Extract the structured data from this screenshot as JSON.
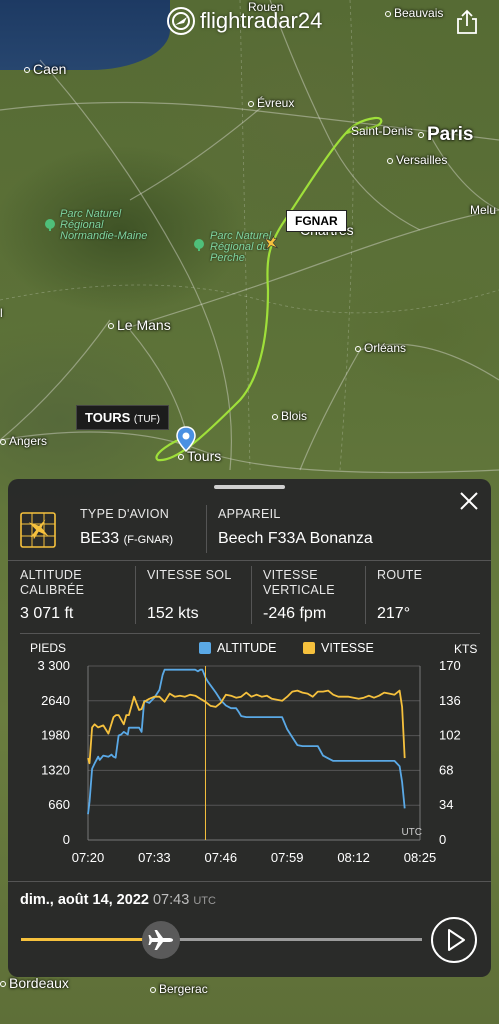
{
  "app": {
    "logo_text": "flightradar24"
  },
  "map": {
    "places": {
      "rouen": "Rouen",
      "beauvais": "Beauvais",
      "caen": "Caen",
      "evreux": "Évreux",
      "saint_denis": "Saint-Denis",
      "paris": "Paris",
      "versailles": "Versailles",
      "melun": "Melu",
      "chartres": "Chartres",
      "le_mans": "Le Mans",
      "orleans": "Orléans",
      "blois": "Blois",
      "angers": "Angers",
      "tours": "Tours",
      "bordeaux": "Bordeaux",
      "bergerac": "Bergerac",
      "edge_l": "l"
    },
    "parks": {
      "normandie_maine": [
        "Parc Naturel",
        "Régional",
        "Normandie-Maine"
      ],
      "perche": [
        "Parc Naturel",
        "Régional du",
        "Perche"
      ]
    },
    "flight_label": "FGNAR",
    "airport_label": "TOURS",
    "airport_code": "(TUF)",
    "track_color": "#9fe03a"
  },
  "panel": {
    "aircraft_type": {
      "label": "TYPE D'AVION",
      "code": "BE33",
      "reg": "(F-GNAR)"
    },
    "aircraft": {
      "label": "APPAREIL",
      "value": "Beech F33A Bonanza"
    },
    "stats": [
      {
        "label": [
          "ALTITUDE",
          "CALIBRÉE"
        ],
        "value": "3 071 ft"
      },
      {
        "label": [
          "VITESSE SOL"
        ],
        "value": "152 kts"
      },
      {
        "label": [
          "VITESSE",
          "VERTICALE"
        ],
        "value": "-246 fpm"
      },
      {
        "label": [
          "ROUTE"
        ],
        "value": "217°"
      }
    ],
    "date": "dim., août 14, 2022",
    "time": "07:43",
    "tz": "UTC",
    "progress": 0.35
  },
  "chart_data": {
    "type": "line",
    "left_axis_label": "PIEDS",
    "right_axis_label": "KTS",
    "tz_label": "UTC",
    "legend": [
      {
        "name": "ALTITUDE",
        "color": "#5aa9e6"
      },
      {
        "name": "VITESSE",
        "color": "#f6c13d"
      }
    ],
    "x_ticks": [
      "07:20",
      "07:33",
      "07:46",
      "07:59",
      "08:12",
      "08:25"
    ],
    "x_range": [
      0,
      65
    ],
    "y_left_ticks": [
      0,
      660,
      1320,
      1980,
      2640,
      3300
    ],
    "y_left_tick_labels": [
      "0",
      "660",
      "1320",
      "1980",
      "2640",
      "3 300"
    ],
    "y_right_ticks": [
      0,
      34,
      68,
      102,
      136,
      170
    ],
    "ylim_left": [
      0,
      3300
    ],
    "ylim_right": [
      0,
      170
    ],
    "cursor_minute": 23,
    "series": [
      {
        "name": "ALTITUDE",
        "axis": "left",
        "color": "#5aa9e6",
        "x": [
          0,
          0.3,
          0.8,
          1.3,
          2,
          2.3,
          3,
          4,
          4.6,
          5,
          5.4,
          6,
          6.5,
          7,
          7.8,
          8,
          10,
          10.5,
          11,
          12,
          12.4,
          13,
          14,
          14.6,
          15,
          16,
          16.4,
          17,
          20,
          21,
          21.5,
          22,
          22.4,
          23,
          23.5,
          25,
          26,
          27,
          28,
          29,
          29.5,
          30,
          31,
          32,
          33,
          34,
          35,
          36,
          37,
          38,
          39,
          40,
          41,
          42,
          43,
          44,
          45,
          46,
          47,
          48,
          49,
          50,
          51,
          52,
          53,
          54,
          55,
          56,
          57,
          58,
          59,
          60,
          61,
          61.5,
          62
        ],
        "y": [
          490,
          720,
          1350,
          1450,
          1580,
          1520,
          1600,
          1580,
          1620,
          1580,
          1560,
          1980,
          2000,
          2050,
          2000,
          2130,
          2130,
          2050,
          2640,
          2600,
          2640,
          2700,
          2850,
          3130,
          3230,
          3230,
          3230,
          3230,
          3230,
          3230,
          3200,
          3230,
          3230,
          3080,
          3000,
          2800,
          2650,
          2550,
          2500,
          2500,
          2430,
          2350,
          2330,
          2330,
          2330,
          2330,
          2330,
          2330,
          2330,
          2330,
          2100,
          1950,
          1800,
          1780,
          1780,
          1780,
          1780,
          1600,
          1550,
          1500,
          1500,
          1500,
          1500,
          1500,
          1500,
          1500,
          1500,
          1500,
          1500,
          1500,
          1500,
          1500,
          1400,
          1100,
          600
        ]
      },
      {
        "name": "VITESSE",
        "axis": "right",
        "color": "#f6c13d",
        "x": [
          0,
          0.3,
          0.8,
          1.3,
          2,
          3,
          4,
          5,
          5.5,
          6,
          7,
          7.5,
          8,
          9,
          10,
          10.5,
          11,
          12,
          13,
          14,
          15,
          16,
          17,
          18,
          19,
          20,
          21,
          22,
          23,
          24,
          25,
          26,
          27,
          28,
          29,
          30,
          31,
          32,
          33,
          34,
          35,
          36,
          37,
          38,
          39,
          40,
          41,
          42,
          43,
          44,
          45,
          46,
          47,
          48,
          49,
          50,
          51,
          52,
          53,
          54,
          55,
          56,
          57,
          58,
          59,
          60,
          61,
          61.5,
          62
        ],
        "y": [
          80,
          75,
          110,
          113,
          110,
          112,
          104,
          120,
          122,
          122,
          113,
          122,
          122,
          140,
          127,
          128,
          135,
          138,
          140,
          140,
          135,
          143,
          140,
          141,
          140,
          142,
          141,
          138,
          135,
          131,
          130,
          134,
          142,
          141,
          139,
          140,
          144,
          140,
          142,
          140,
          141,
          138,
          137,
          136,
          140,
          145,
          146,
          144,
          143,
          140,
          145,
          145,
          146,
          142,
          140,
          140,
          140,
          139,
          138,
          139,
          141,
          139,
          141,
          144,
          143,
          142,
          146,
          130,
          80
        ]
      }
    ]
  }
}
